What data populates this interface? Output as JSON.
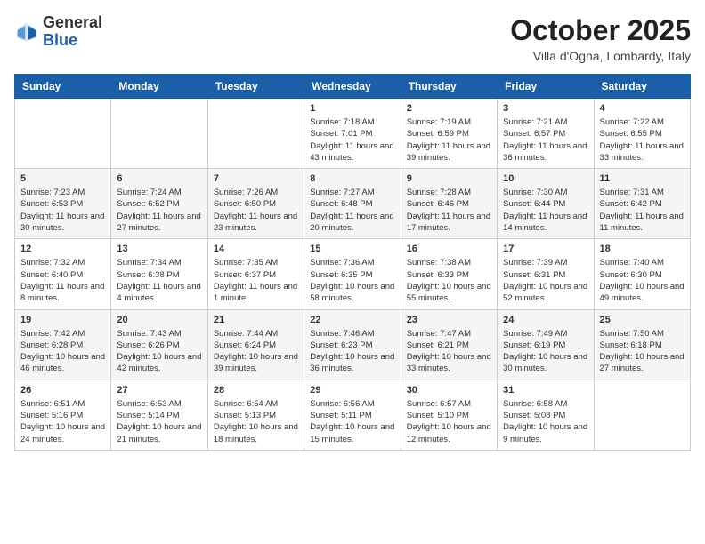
{
  "header": {
    "logo_general": "General",
    "logo_blue": "Blue",
    "month_title": "October 2025",
    "location": "Villa d'Ogna, Lombardy, Italy"
  },
  "days_of_week": [
    "Sunday",
    "Monday",
    "Tuesday",
    "Wednesday",
    "Thursday",
    "Friday",
    "Saturday"
  ],
  "weeks": [
    [
      {
        "day": "",
        "info": ""
      },
      {
        "day": "",
        "info": ""
      },
      {
        "day": "",
        "info": ""
      },
      {
        "day": "1",
        "info": "Sunrise: 7:18 AM\nSunset: 7:01 PM\nDaylight: 11 hours and 43 minutes."
      },
      {
        "day": "2",
        "info": "Sunrise: 7:19 AM\nSunset: 6:59 PM\nDaylight: 11 hours and 39 minutes."
      },
      {
        "day": "3",
        "info": "Sunrise: 7:21 AM\nSunset: 6:57 PM\nDaylight: 11 hours and 36 minutes."
      },
      {
        "day": "4",
        "info": "Sunrise: 7:22 AM\nSunset: 6:55 PM\nDaylight: 11 hours and 33 minutes."
      }
    ],
    [
      {
        "day": "5",
        "info": "Sunrise: 7:23 AM\nSunset: 6:53 PM\nDaylight: 11 hours and 30 minutes."
      },
      {
        "day": "6",
        "info": "Sunrise: 7:24 AM\nSunset: 6:52 PM\nDaylight: 11 hours and 27 minutes."
      },
      {
        "day": "7",
        "info": "Sunrise: 7:26 AM\nSunset: 6:50 PM\nDaylight: 11 hours and 23 minutes."
      },
      {
        "day": "8",
        "info": "Sunrise: 7:27 AM\nSunset: 6:48 PM\nDaylight: 11 hours and 20 minutes."
      },
      {
        "day": "9",
        "info": "Sunrise: 7:28 AM\nSunset: 6:46 PM\nDaylight: 11 hours and 17 minutes."
      },
      {
        "day": "10",
        "info": "Sunrise: 7:30 AM\nSunset: 6:44 PM\nDaylight: 11 hours and 14 minutes."
      },
      {
        "day": "11",
        "info": "Sunrise: 7:31 AM\nSunset: 6:42 PM\nDaylight: 11 hours and 11 minutes."
      }
    ],
    [
      {
        "day": "12",
        "info": "Sunrise: 7:32 AM\nSunset: 6:40 PM\nDaylight: 11 hours and 8 minutes."
      },
      {
        "day": "13",
        "info": "Sunrise: 7:34 AM\nSunset: 6:38 PM\nDaylight: 11 hours and 4 minutes."
      },
      {
        "day": "14",
        "info": "Sunrise: 7:35 AM\nSunset: 6:37 PM\nDaylight: 11 hours and 1 minute."
      },
      {
        "day": "15",
        "info": "Sunrise: 7:36 AM\nSunset: 6:35 PM\nDaylight: 10 hours and 58 minutes."
      },
      {
        "day": "16",
        "info": "Sunrise: 7:38 AM\nSunset: 6:33 PM\nDaylight: 10 hours and 55 minutes."
      },
      {
        "day": "17",
        "info": "Sunrise: 7:39 AM\nSunset: 6:31 PM\nDaylight: 10 hours and 52 minutes."
      },
      {
        "day": "18",
        "info": "Sunrise: 7:40 AM\nSunset: 6:30 PM\nDaylight: 10 hours and 49 minutes."
      }
    ],
    [
      {
        "day": "19",
        "info": "Sunrise: 7:42 AM\nSunset: 6:28 PM\nDaylight: 10 hours and 46 minutes."
      },
      {
        "day": "20",
        "info": "Sunrise: 7:43 AM\nSunset: 6:26 PM\nDaylight: 10 hours and 42 minutes."
      },
      {
        "day": "21",
        "info": "Sunrise: 7:44 AM\nSunset: 6:24 PM\nDaylight: 10 hours and 39 minutes."
      },
      {
        "day": "22",
        "info": "Sunrise: 7:46 AM\nSunset: 6:23 PM\nDaylight: 10 hours and 36 minutes."
      },
      {
        "day": "23",
        "info": "Sunrise: 7:47 AM\nSunset: 6:21 PM\nDaylight: 10 hours and 33 minutes."
      },
      {
        "day": "24",
        "info": "Sunrise: 7:49 AM\nSunset: 6:19 PM\nDaylight: 10 hours and 30 minutes."
      },
      {
        "day": "25",
        "info": "Sunrise: 7:50 AM\nSunset: 6:18 PM\nDaylight: 10 hours and 27 minutes."
      }
    ],
    [
      {
        "day": "26",
        "info": "Sunrise: 6:51 AM\nSunset: 5:16 PM\nDaylight: 10 hours and 24 minutes."
      },
      {
        "day": "27",
        "info": "Sunrise: 6:53 AM\nSunset: 5:14 PM\nDaylight: 10 hours and 21 minutes."
      },
      {
        "day": "28",
        "info": "Sunrise: 6:54 AM\nSunset: 5:13 PM\nDaylight: 10 hours and 18 minutes."
      },
      {
        "day": "29",
        "info": "Sunrise: 6:56 AM\nSunset: 5:11 PM\nDaylight: 10 hours and 15 minutes."
      },
      {
        "day": "30",
        "info": "Sunrise: 6:57 AM\nSunset: 5:10 PM\nDaylight: 10 hours and 12 minutes."
      },
      {
        "day": "31",
        "info": "Sunrise: 6:58 AM\nSunset: 5:08 PM\nDaylight: 10 hours and 9 minutes."
      },
      {
        "day": "",
        "info": ""
      }
    ]
  ]
}
